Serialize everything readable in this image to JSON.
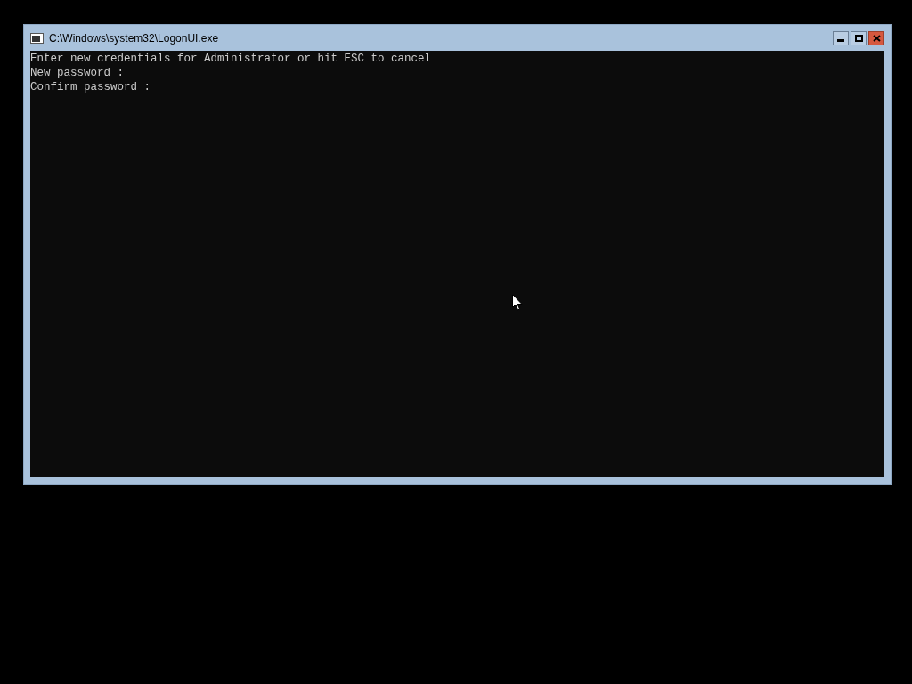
{
  "window": {
    "title": "C:\\Windows\\system32\\LogonUI.exe"
  },
  "console": {
    "lines": [
      "Enter new credentials for Administrator or hit ESC to cancel",
      "New password :",
      "Confirm password :"
    ]
  }
}
